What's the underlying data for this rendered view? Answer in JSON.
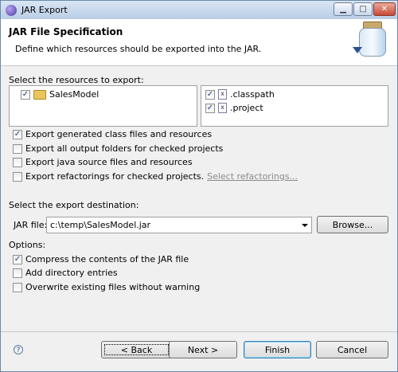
{
  "window": {
    "title": "JAR Export",
    "minimize": "▁",
    "maximize": "□",
    "close": "✕"
  },
  "header": {
    "title": "JAR File Specification",
    "description": "Define which resources should be exported into the JAR."
  },
  "resources": {
    "label": "Select the resources to export:",
    "project": "SalesModel",
    "files": [
      ".classpath",
      ".project"
    ]
  },
  "options_export": [
    {
      "label": "Export generated class files and resources",
      "checked": true
    },
    {
      "label": "Export all output folders for checked projects",
      "checked": false
    },
    {
      "label": "Export java source files and resources",
      "checked": false
    },
    {
      "label": "Export refactorings for checked projects.",
      "checked": false
    }
  ],
  "select_refactorings": "Select refactorings...",
  "destination": {
    "label": "Select the export destination:",
    "jar_label": "JAR file:",
    "jar_value": "c:\\temp\\SalesModel.jar",
    "browse": "Browse..."
  },
  "options": {
    "label": "Options:",
    "items": [
      {
        "label": "Compress the contents of the JAR file",
        "checked": true
      },
      {
        "label": "Add directory entries",
        "checked": false
      },
      {
        "label": "Overwrite existing files without warning",
        "checked": false
      }
    ]
  },
  "buttons": {
    "help": "?",
    "back": "< Back",
    "next": "Next >",
    "finish": "Finish",
    "cancel": "Cancel"
  }
}
